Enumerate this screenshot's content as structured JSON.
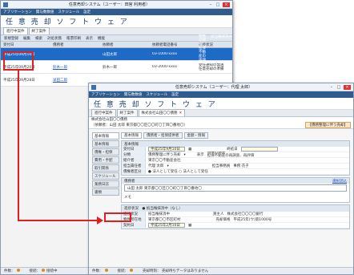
{
  "win1": {
    "title": "任意売却システム（ユーザー：田宮 利用者）",
    "menu": [
      "アプリケーション",
      "関与数数値",
      "スケジュール",
      "設定"
    ],
    "brand": "任 意 売 却 ソ フ ト ウ ェ ア",
    "tabs": [
      "進行中案件",
      "終了案件"
    ],
    "toolbar": [
      "新規登録",
      "編集",
      "検索",
      "対処状態",
      "帳票印刷",
      "表示",
      "機能"
    ],
    "table": {
      "headers": [
        "受付日",
        "債務者",
        "依頼者",
        "依頼者電話番号",
        "進捗状況"
      ],
      "rows": [
        {
          "date": "平成25年09月10日",
          "debtor": "",
          "client": "山田太郎",
          "phone": "03-1000-xxxx",
          "progress": "債権の調査\n担保不動産の再調査、再評価",
          "status": "抵当権抹消中",
          "selected": true
        },
        {
          "date": "平成25年09月20日",
          "debtor": "鈴木一郎",
          "client": "鈴木一郎",
          "phone": "03-2000-xxxx",
          "progress": "受任通知の発送\n任意売却の準備",
          "status": "",
          "selected": false
        },
        {
          "date": "平成25年09月28日",
          "debtor": "早田二郎",
          "client": "",
          "phone": "",
          "progress": "",
          "status": "",
          "selected": false
        }
      ]
    },
    "status": {
      "left": "件数：",
      "mid": "接続：",
      "right": "接続中"
    }
  },
  "win2": {
    "title": "任意売却システム（ユーザー：代理 太郎）",
    "menu": [
      "アプリケーション",
      "関与数数値",
      "スケジュール",
      "設定"
    ],
    "brand": "任 意 売 却 ソ フ ト ウ ェ ア",
    "tabs": [
      "進行中案件",
      "終了案件",
      "株式会社山田〇〇債務"
    ],
    "case_line": "株式会社山田〇〇債務",
    "debtor_line": "（依頼者：山田 太郎 東京都〇〇区〇〇町〇丁目〇番地〇）",
    "header_pill": "【債務整理に伴う売却】",
    "side": [
      "基本情報",
      "基本情報",
      "債権・担保",
      "費用・手配",
      "取引関係",
      "スケジュール",
      "業務日誌",
      "書類"
    ],
    "subtabs": [
      "基本情報",
      "債務者・担保提供者",
      "金額・情報"
    ],
    "basic": {
      "head": "基本情報",
      "fields": [
        {
          "label": "受付日",
          "value": "平成25年9月10日"
        },
        {
          "label": "分類",
          "value": "債務整理に伴う売却"
        },
        {
          "label": "紹介者",
          "value": "東京〇〇不動産会社"
        },
        {
          "label": "担当責任者",
          "value": "代理 太郎"
        },
        {
          "label": "債権者区分",
          "value": "● 法人として受任 ○ 法人として受任"
        }
      ],
      "right_labels": {
        "finish": "終結日",
        "display": "表示",
        "progress": "債権の調査\n担保不動産の再調査、再評価",
        "person_label": "担当事務員",
        "person": "事務 花子"
      },
      "edit": "編集"
    },
    "debtor": {
      "head": "債務者",
      "link": "選択読込",
      "address": "山田 太郎 東京都〇〇区〇〇町〇丁目〇番地〇",
      "memo_label": "メモ",
      "edit": "編集"
    },
    "progress": {
      "strip": "進捗状況　● 抵当権抹消中（なし）",
      "fields": [
        {
          "label": "進捗状況",
          "value": "抵当権抹消中"
        },
        {
          "label": "物件所在地",
          "value": "東京都〇〇市区町村"
        },
        {
          "label": "契約日",
          "value": "平成25年2月10日"
        }
      ],
      "right": {
        "buyer_label": "買主人",
        "buyer": "株式会社〇〇〇〇銀行",
        "amount_label": "売却価格",
        "amount": "平成25年(ウ)第1000号"
      }
    },
    "status": {
      "left": "件数：",
      "mid": "接続：",
      "right": "売却時刻：",
      "note": "売却待ちデータはありません"
    }
  }
}
